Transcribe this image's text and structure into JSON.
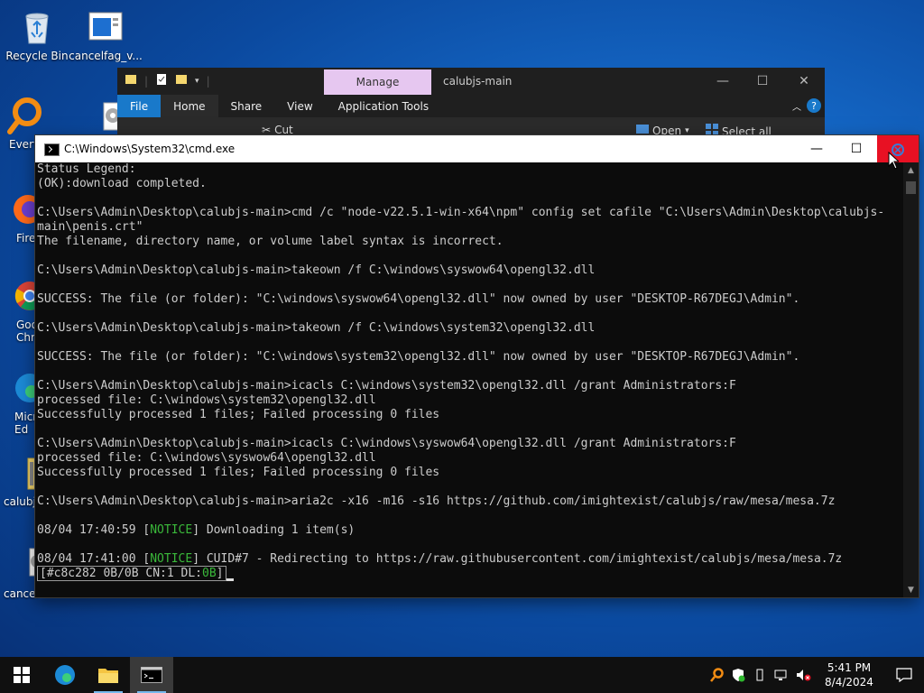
{
  "desktop": {
    "icons": [
      {
        "label": "Recycle Bin"
      },
      {
        "label": "cancelfag_v..."
      },
      {
        "label": "Every"
      },
      {
        "label": "Fire"
      },
      {
        "label": "Goo Chro"
      },
      {
        "label": "Micr Ed"
      },
      {
        "label": "calubjs"
      },
      {
        "label": "cancel"
      }
    ]
  },
  "explorer": {
    "manage_tab": "Manage",
    "title": "calubjs-main",
    "tabs": [
      "File",
      "Home",
      "Share",
      "View",
      "Application Tools"
    ],
    "ribbon": {
      "cut": "Cut",
      "open": "Open",
      "select_all": "Select all"
    },
    "help": "?"
  },
  "cmd": {
    "title": "C:\\Windows\\System32\\cmd.exe",
    "lines": [
      "Status Legend:",
      "(OK):download completed.",
      "",
      "C:\\Users\\Admin\\Desktop\\calubjs-main>cmd /c \"node-v22.5.1-win-x64\\npm\" config set cafile \"C:\\Users\\Admin\\Desktop\\calubjs-",
      "main\\penis.crt\"",
      "The filename, directory name, or volume label syntax is incorrect.",
      "",
      "C:\\Users\\Admin\\Desktop\\calubjs-main>takeown /f C:\\windows\\syswow64\\opengl32.dll",
      "",
      "SUCCESS: The file (or folder): \"C:\\windows\\syswow64\\opengl32.dll\" now owned by user \"DESKTOP-R67DEGJ\\Admin\".",
      "",
      "C:\\Users\\Admin\\Desktop\\calubjs-main>takeown /f C:\\windows\\system32\\opengl32.dll",
      "",
      "SUCCESS: The file (or folder): \"C:\\windows\\system32\\opengl32.dll\" now owned by user \"DESKTOP-R67DEGJ\\Admin\".",
      "",
      "C:\\Users\\Admin\\Desktop\\calubjs-main>icacls C:\\windows\\system32\\opengl32.dll /grant Administrators:F",
      "processed file: C:\\windows\\system32\\opengl32.dll",
      "Successfully processed 1 files; Failed processing 0 files",
      "",
      "C:\\Users\\Admin\\Desktop\\calubjs-main>icacls C:\\windows\\syswow64\\opengl32.dll /grant Administrators:F",
      "processed file: C:\\windows\\syswow64\\opengl32.dll",
      "Successfully processed 1 files; Failed processing 0 files",
      "",
      "C:\\Users\\Admin\\Desktop\\calubjs-main>aria2c -x16 -m16 -s16 https://github.com/imightexist/calubjs/raw/mesa/mesa.7z",
      ""
    ],
    "notice1": {
      "prefix": "08/04 17:40:59 [",
      "tag": "NOTICE",
      "suffix": "] Downloading 1 item(s)"
    },
    "notice2": {
      "prefix": "08/04 17:41:00 [",
      "tag": "NOTICE",
      "suffix": "] CUID#7 - Redirecting to https://raw.githubusercontent.com/imightexist/calubjs/mesa/mesa.7z"
    },
    "status": {
      "prefix": "[#c8c282 0B/0B CN:1 DL:",
      "dl": "0B",
      "suffix": "]"
    }
  },
  "taskbar": {
    "time": "5:41 PM",
    "date": "8/4/2024"
  }
}
